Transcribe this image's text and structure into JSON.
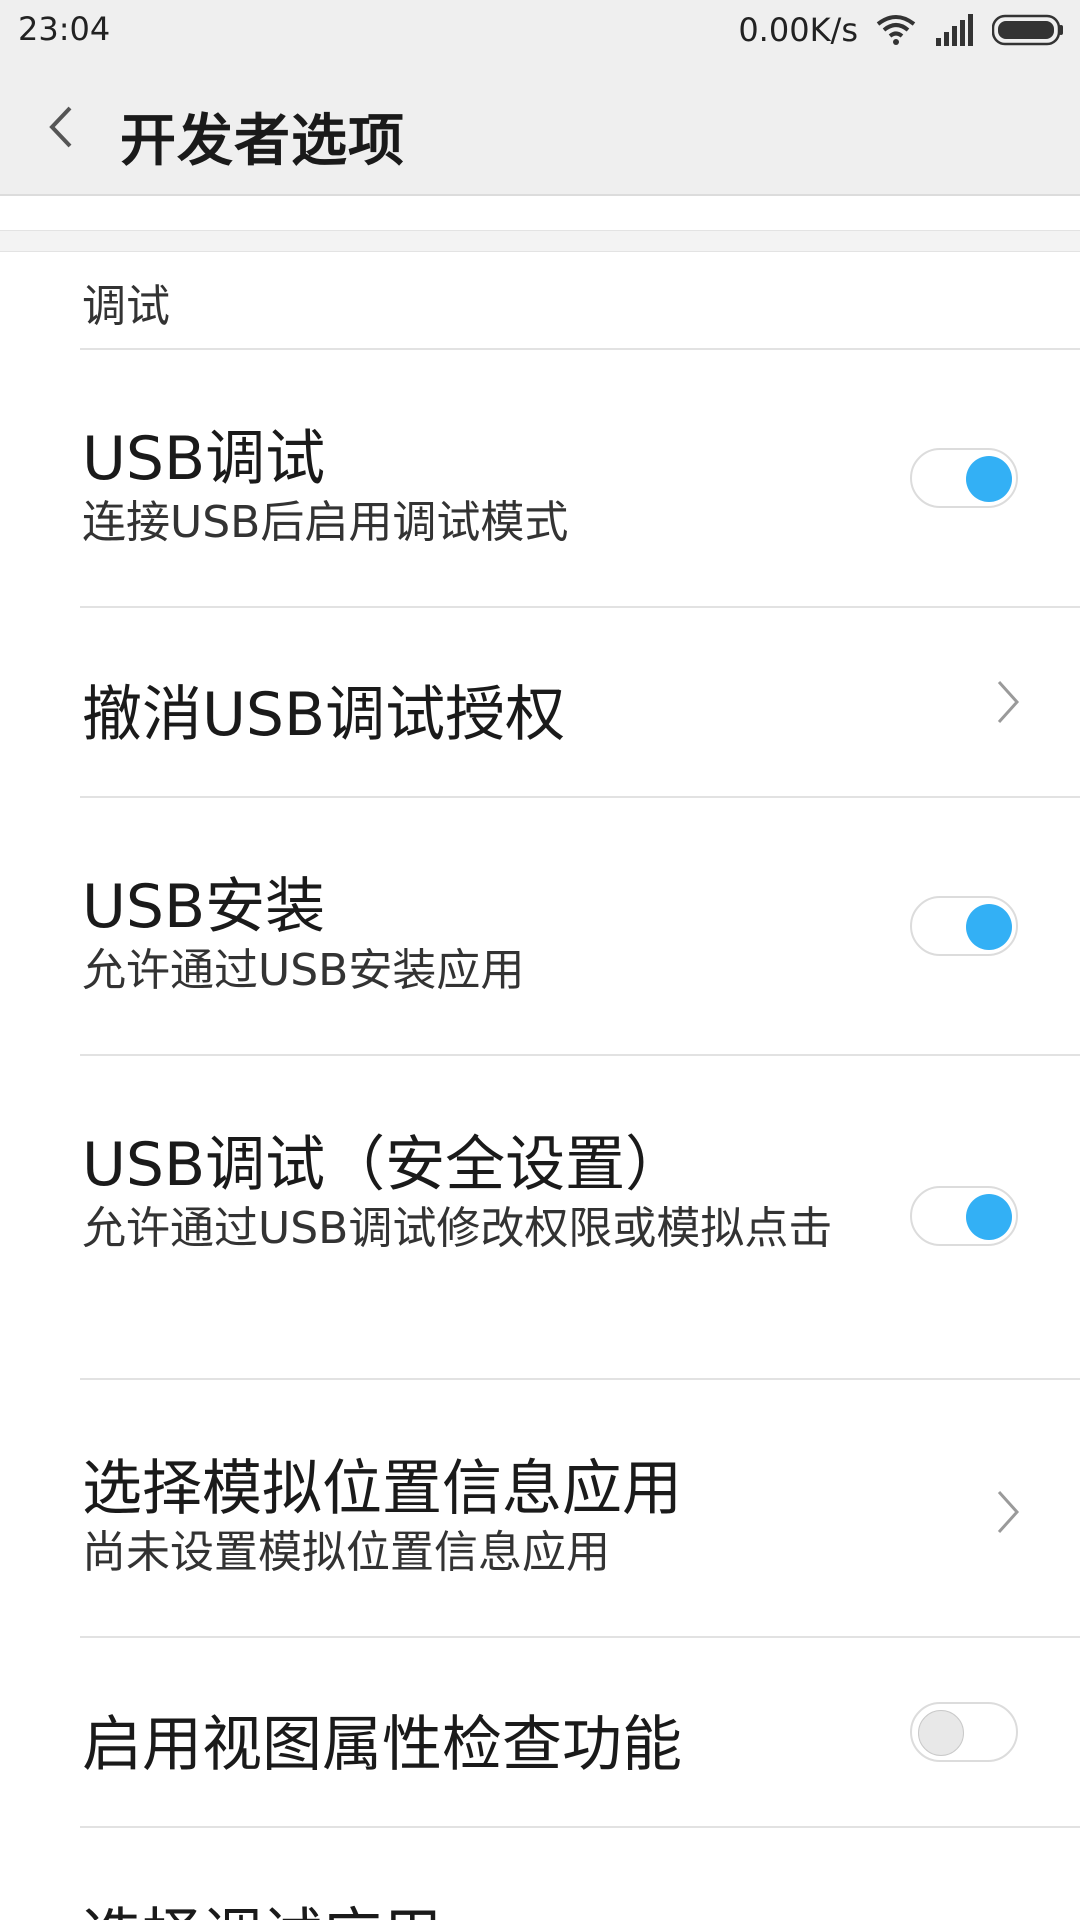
{
  "status_bar": {
    "time": "23:04",
    "net_speed": "0.00K/s"
  },
  "header": {
    "title": "开发者选项"
  },
  "section": {
    "label": "调试"
  },
  "items": [
    {
      "title": "USB调试",
      "subtitle": "连接USB后启用调试模式",
      "control": "toggle",
      "checked": true
    },
    {
      "title": "撤消USB调试授权",
      "control": "chevron"
    },
    {
      "title": "USB安装",
      "subtitle": "允许通过USB安装应用",
      "control": "toggle",
      "checked": true
    },
    {
      "title": "USB调试（安全设置）",
      "subtitle": "允许通过USB调试修改权限或模拟点击",
      "control": "toggle",
      "checked": true
    },
    {
      "title": "选择模拟位置信息应用",
      "subtitle": "尚未设置模拟位置信息应用",
      "control": "chevron"
    },
    {
      "title": "启用视图属性检查功能",
      "control": "toggle",
      "checked": false
    },
    {
      "title": "选择调试应用"
    }
  ],
  "colors": {
    "accent": "#33b0f5",
    "background": "#ffffff",
    "header_bg": "#efefef"
  }
}
